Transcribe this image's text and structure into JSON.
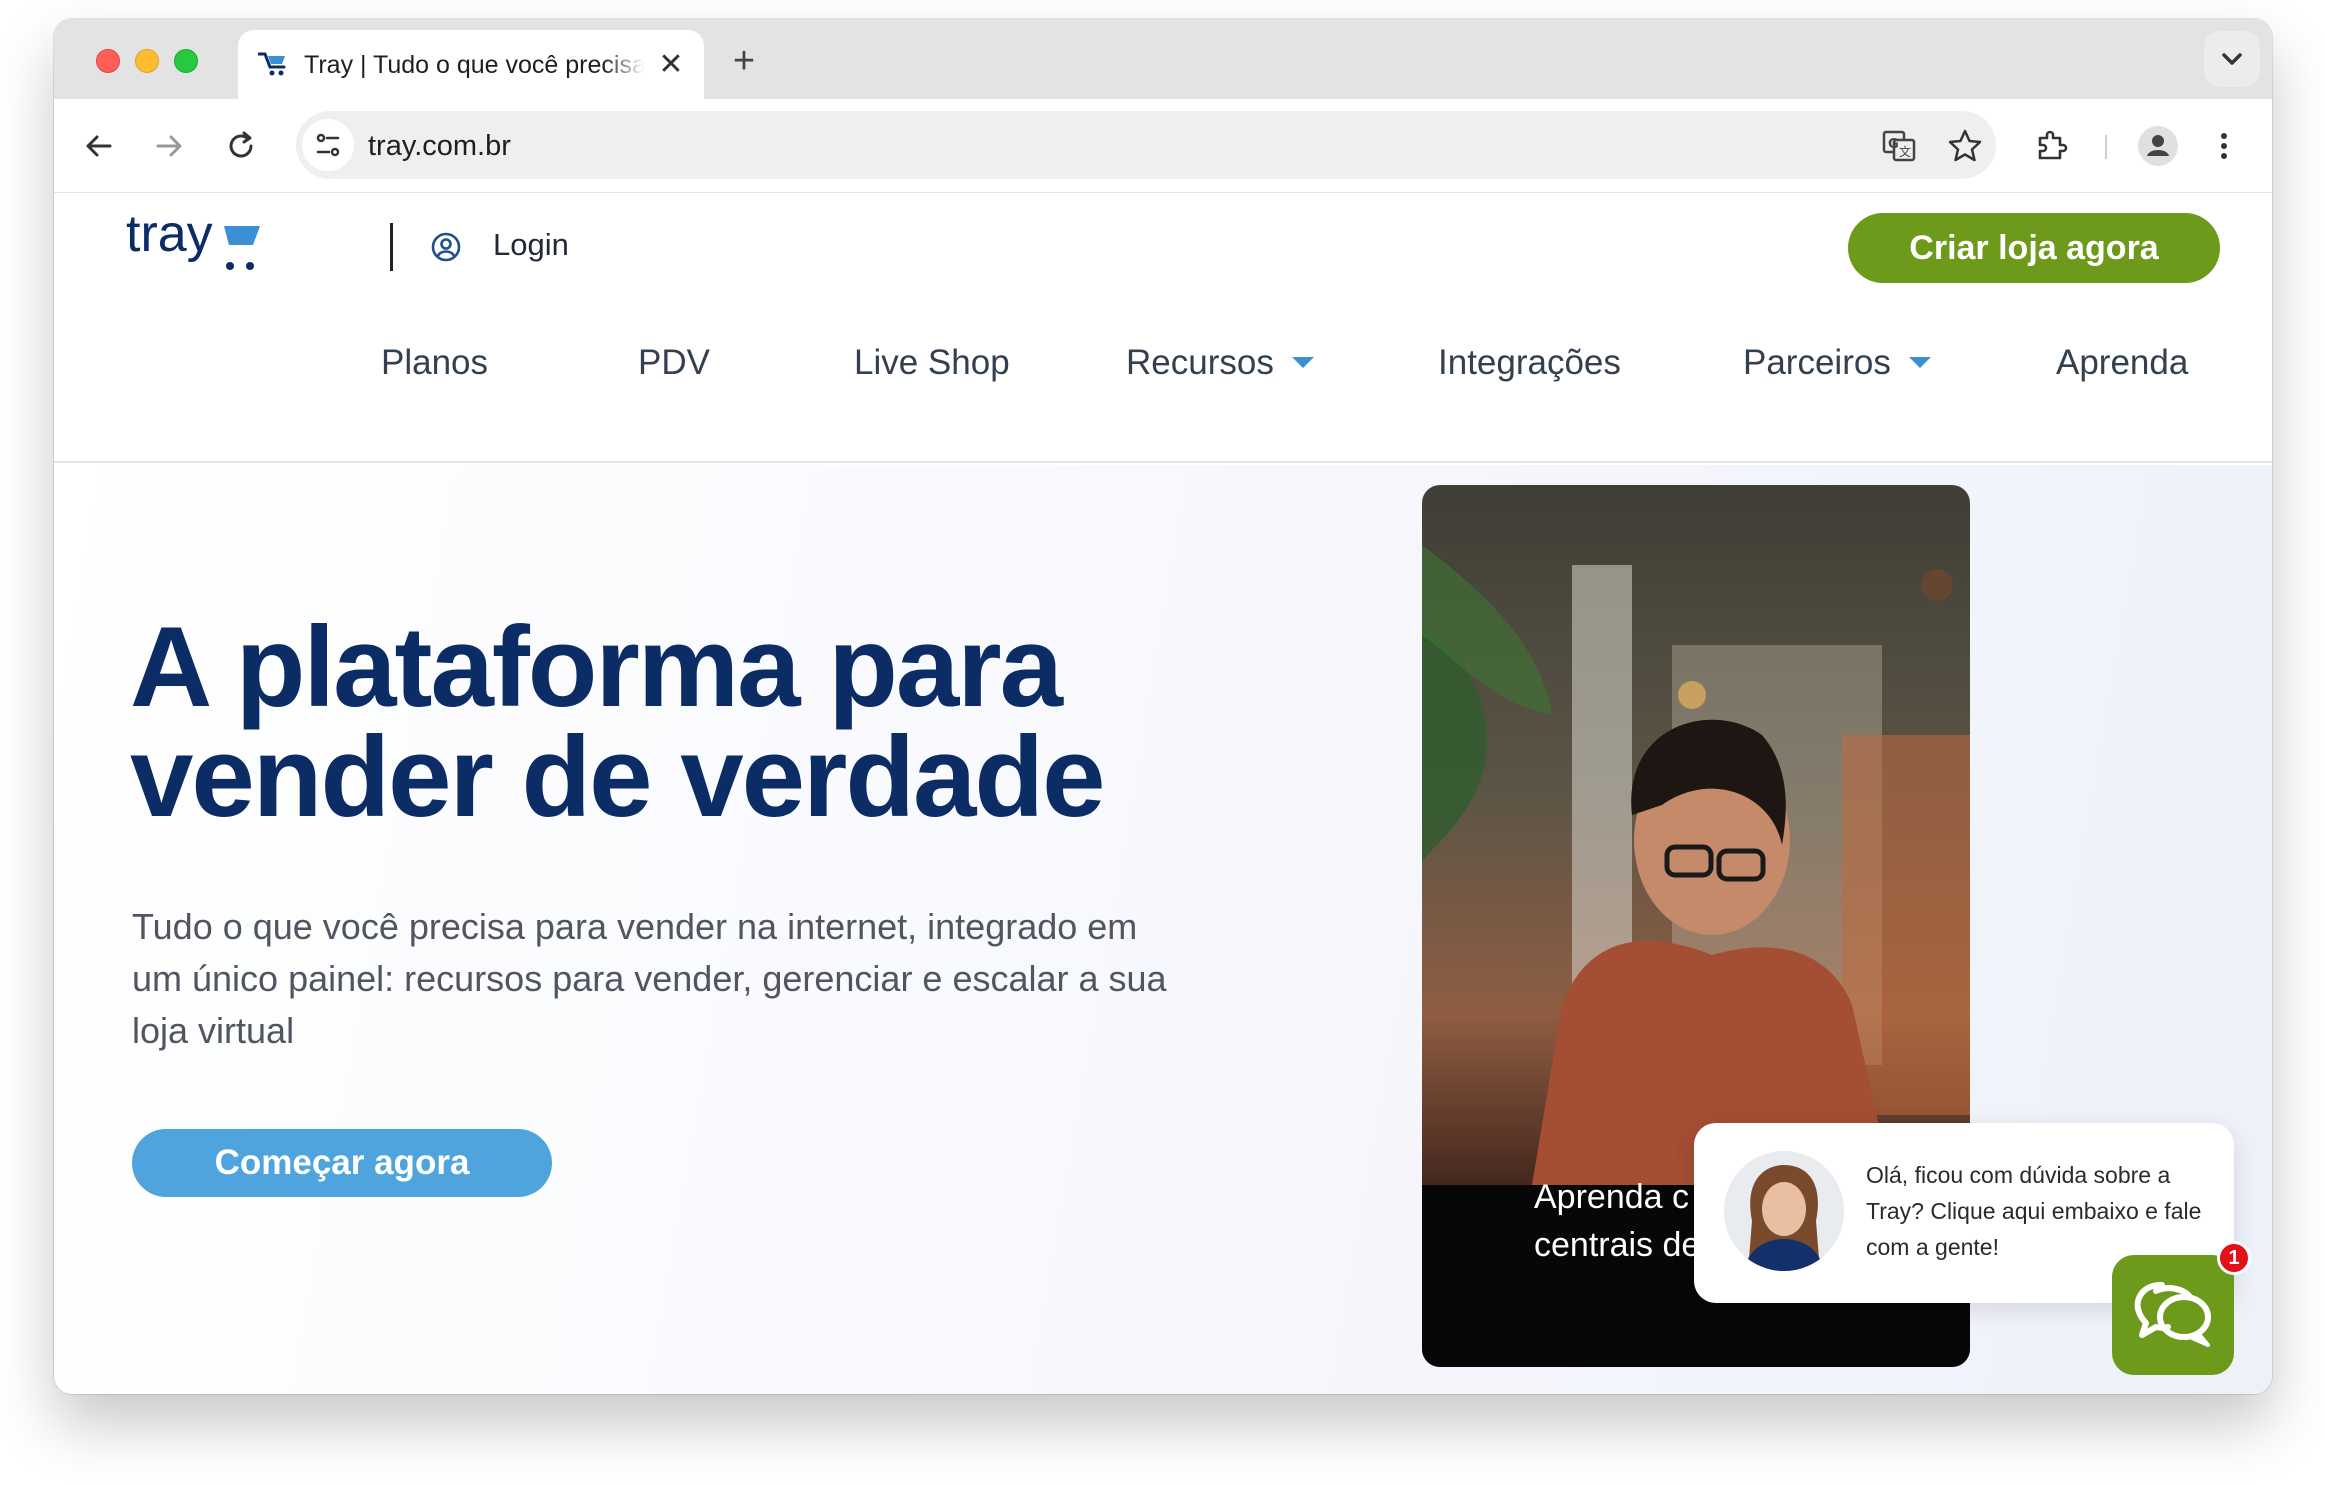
{
  "browser": {
    "tab": {
      "title": "Tray | Tudo o que você precisa"
    },
    "omnibox": {
      "url": "tray.com.br"
    },
    "icons": [
      "back-icon",
      "forward-icon",
      "reload-icon",
      "site-info-icon",
      "translate-icon",
      "star-icon",
      "extensions-icon",
      "profile-icon",
      "menu-icon"
    ]
  },
  "header": {
    "logo_text": "tray",
    "login_label": "Login",
    "cta_label": "Criar loja agora",
    "nav": {
      "planos": "Planos",
      "pdv": "PDV",
      "live_shop": "Live Shop",
      "recursos": "Recursos",
      "integracoes": "Integrações",
      "parceiros": "Parceiros",
      "aprenda": "Aprenda"
    }
  },
  "hero": {
    "headline_line1": "A plataforma para",
    "headline_line2": "vender de verdade",
    "subtext": "Tudo o que você precisa para vender na internet, integrado em um único painel: recursos para vender, gerenciar e escalar a sua loja virtual",
    "cta_label": "Começar agora",
    "card_caption_line1": "Aprenda c",
    "card_caption_line2": "centrais de"
  },
  "chat": {
    "message": "Olá, ficou com dúvida sobre a Tray? Clique aqui embaixo e fale com a gente!",
    "badge_count": "1"
  },
  "colors": {
    "navy": "#0c2c66",
    "green": "#6d9a1a",
    "blue": "#4fa4dd",
    "badge_red": "#e3101a"
  }
}
